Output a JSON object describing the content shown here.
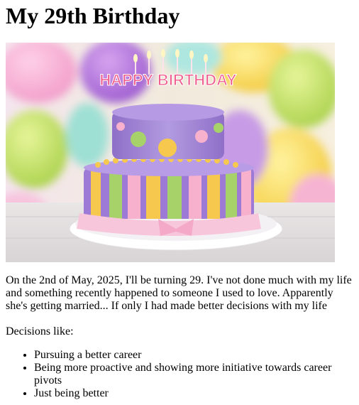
{
  "title": "My 29th Birthday",
  "cake_topper_text": "HAPPY BIRTHDAY",
  "intro": "On the 2nd of May, 2025, I'll be turning 29. I've not done much with my life and something recently happened to someone I used to love. Apparently she's getting married... If only I had made better decisions with my life",
  "decisions_lead": "Decisions like:",
  "decisions": [
    "Pursuing a better career",
    "Being more proactive and showing more initiative towards career pivots",
    "Just being better"
  ]
}
